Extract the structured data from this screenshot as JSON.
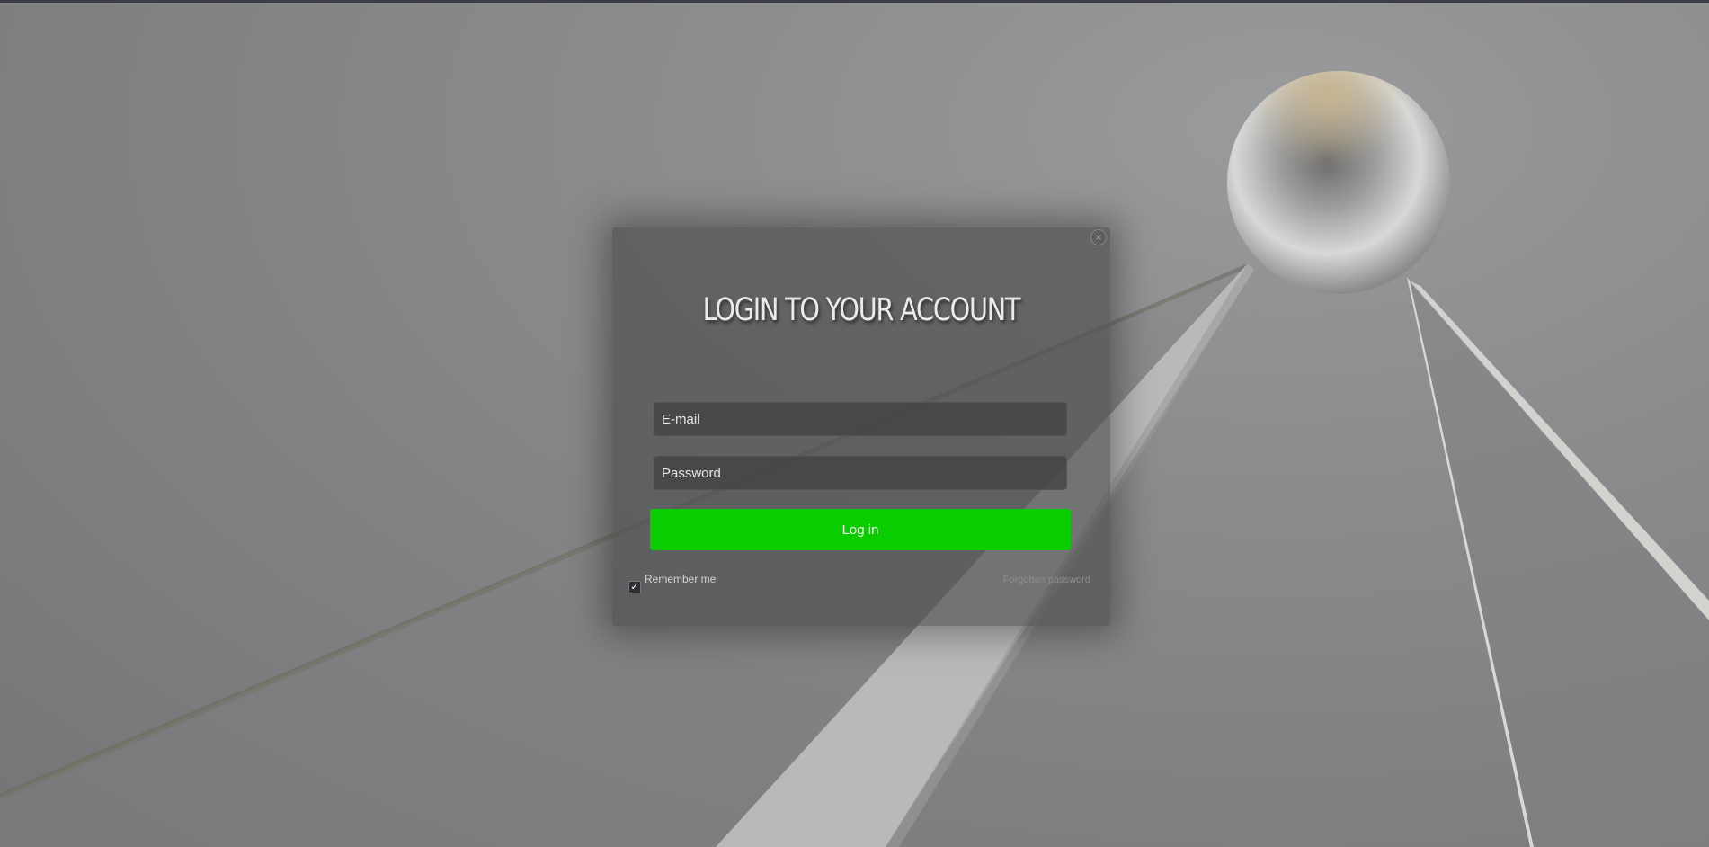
{
  "modal": {
    "title": "LOGIN TO YOUR ACCOUNT",
    "close_icon": "close-icon",
    "email_placeholder": "E-mail",
    "email_value": "",
    "password_placeholder": "Password",
    "password_value": "",
    "login_label": "Log in",
    "remember_label": "Remember me",
    "remember_checked": true,
    "checkbox_mark": "✓",
    "forgot_label": "Forgotten password"
  },
  "colors": {
    "accent_button": "#0acd00",
    "top_border": "#3b3d4a"
  },
  "background": {
    "decoration": "metal-sphere-with-light-beams"
  }
}
